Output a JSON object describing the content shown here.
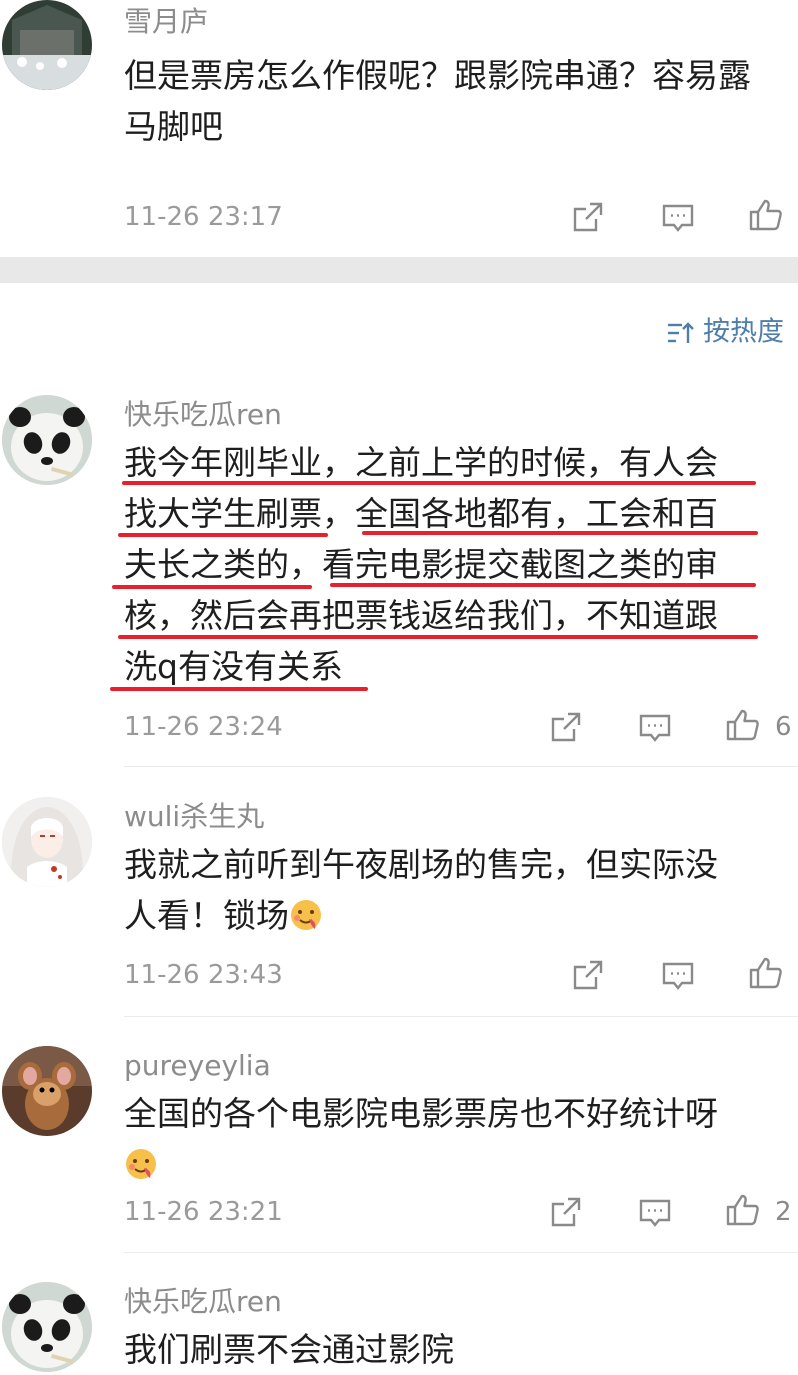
{
  "comments": [
    {
      "username": "雪月庐",
      "lines": [
        "但是票房怎么作假呢？跟影院串通？容易露",
        "马脚吧"
      ],
      "time": "11-26 23:17",
      "likes": ""
    },
    {
      "username": "快乐吃瓜ren",
      "lines": [
        "我今年刚毕业，之前上学的时候，有人会",
        "找大学生刷票，全国各地都有，工会和百",
        "夫长之类的，看完电影提交截图之类的审",
        "核，然后会再把票钱返给我们，不知道跟",
        "洗q有没有关系"
      ],
      "time": "11-26 23:24",
      "likes": "6"
    },
    {
      "username": "wuli杀生丸",
      "lines": [
        "我就之前听到午夜剧场的售完，但实际没",
        "人看！锁场"
      ],
      "time": "11-26 23:43",
      "likes": ""
    },
    {
      "username": "pureyeylia",
      "lines": [
        "全国的各个电影院电影票房也不好统计呀",
        ""
      ],
      "time": "11-26 23:21",
      "likes": "2"
    },
    {
      "username": "快乐吃瓜ren",
      "lines": [
        "我们刷票不会通过影院"
      ],
      "time": "",
      "likes": ""
    }
  ],
  "sort": {
    "label": "按热度",
    "icon": "sort-icon"
  },
  "icons": {
    "share": "share-icon",
    "reply": "comment-icon",
    "like": "thumbs-up-icon",
    "emoji": "hot-face-emoji"
  },
  "colors": {
    "accent": "#4d7faa",
    "underline": "#e8202c",
    "band": "#e8e8e8"
  }
}
